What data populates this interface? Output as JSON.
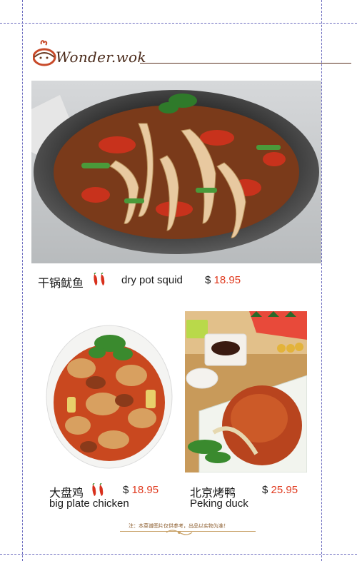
{
  "brand": {
    "logo_text": "Wonder.wok"
  },
  "dishes": [
    {
      "name_cn": "干锅鱿鱼",
      "name_en": "dry pot squid",
      "currency": "$",
      "price": "18.95",
      "spicy": 2
    },
    {
      "name_cn": "大盘鸡",
      "name_en": "big plate chicken",
      "currency": "$",
      "price": "18.95",
      "spicy": 2
    },
    {
      "name_cn": "北京烤鸭",
      "name_en": "Peking duck",
      "currency": "$",
      "price": "25.95",
      "spicy": 0
    }
  ],
  "footer": {
    "note": "注：本菜谱图片仅供参考，出品以实物为准！"
  },
  "colors": {
    "price": "#e03a1f",
    "brand": "#4a2a1a",
    "guide": "#6b6bbf",
    "chili": "#d8301c"
  }
}
